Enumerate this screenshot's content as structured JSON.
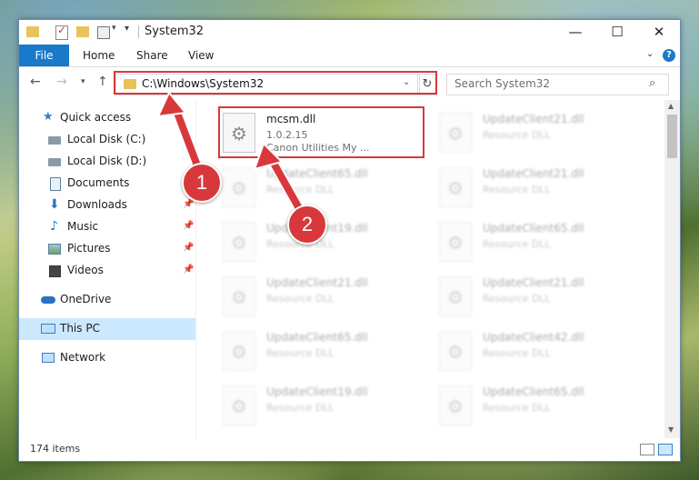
{
  "window": {
    "title": "System32",
    "min_icon": "minimize-icon",
    "max_icon": "maximize-icon",
    "close_icon": "close-icon"
  },
  "ribbon": {
    "tabs": [
      {
        "label": "File"
      },
      {
        "label": "Home"
      },
      {
        "label": "Share"
      },
      {
        "label": "View"
      }
    ],
    "help": "?",
    "accent": "#1979ca"
  },
  "navbar": {
    "address": "C:\\Windows\\System32",
    "search_placeholder": "Search System32"
  },
  "sidebar": {
    "items": [
      {
        "label": "Quick access",
        "icon": "star-icon"
      },
      {
        "label": "Local Disk (C:)",
        "icon": "disk-icon"
      },
      {
        "label": "Local Disk (D:)",
        "icon": "disk-icon"
      },
      {
        "label": "Documents",
        "icon": "documents-icon",
        "pinned": true
      },
      {
        "label": "Downloads",
        "icon": "downloads-icon",
        "pinned": true
      },
      {
        "label": "Music",
        "icon": "music-icon",
        "pinned": true
      },
      {
        "label": "Pictures",
        "icon": "pictures-icon",
        "pinned": true
      },
      {
        "label": "Videos",
        "icon": "videos-icon",
        "pinned": true
      },
      {
        "label": "OneDrive",
        "icon": "onedrive-icon"
      },
      {
        "label": "This PC",
        "icon": "pc-icon",
        "selected": true
      },
      {
        "label": "Network",
        "icon": "network-icon"
      }
    ]
  },
  "files": {
    "highlighted": {
      "name": "mcsm.dll",
      "version": "1.0.2.15",
      "company": "Canon Utilities My ..."
    },
    "others": [
      {
        "name": "UpdateClient21.dll",
        "type": "Resource DLL"
      },
      {
        "name": "UpdateClient65.dll",
        "type": "Resource DLL"
      },
      {
        "name": "UpdateClient21.dll",
        "type": "Resource DLL"
      },
      {
        "name": "UpdateClient19.dll",
        "type": "Resource DLL"
      },
      {
        "name": "UpdateClient65.dll",
        "type": "Resource DLL"
      },
      {
        "name": "UpdateClient21.dll",
        "type": "Resource DLL"
      },
      {
        "name": "UpdateClient21.dll",
        "type": "Resource DLL"
      },
      {
        "name": "UpdateClient65.dll",
        "type": "Resource DLL"
      },
      {
        "name": "UpdateClient42.dll",
        "type": "Resource DLL"
      },
      {
        "name": "UpdateClient19.dll",
        "type": "Resource DLL"
      },
      {
        "name": "UpdateClient65.dll",
        "type": "Resource DLL"
      }
    ]
  },
  "status": {
    "count": "174 items"
  },
  "annotations": {
    "step1": "1",
    "step2": "2",
    "color": "#d8383b"
  }
}
